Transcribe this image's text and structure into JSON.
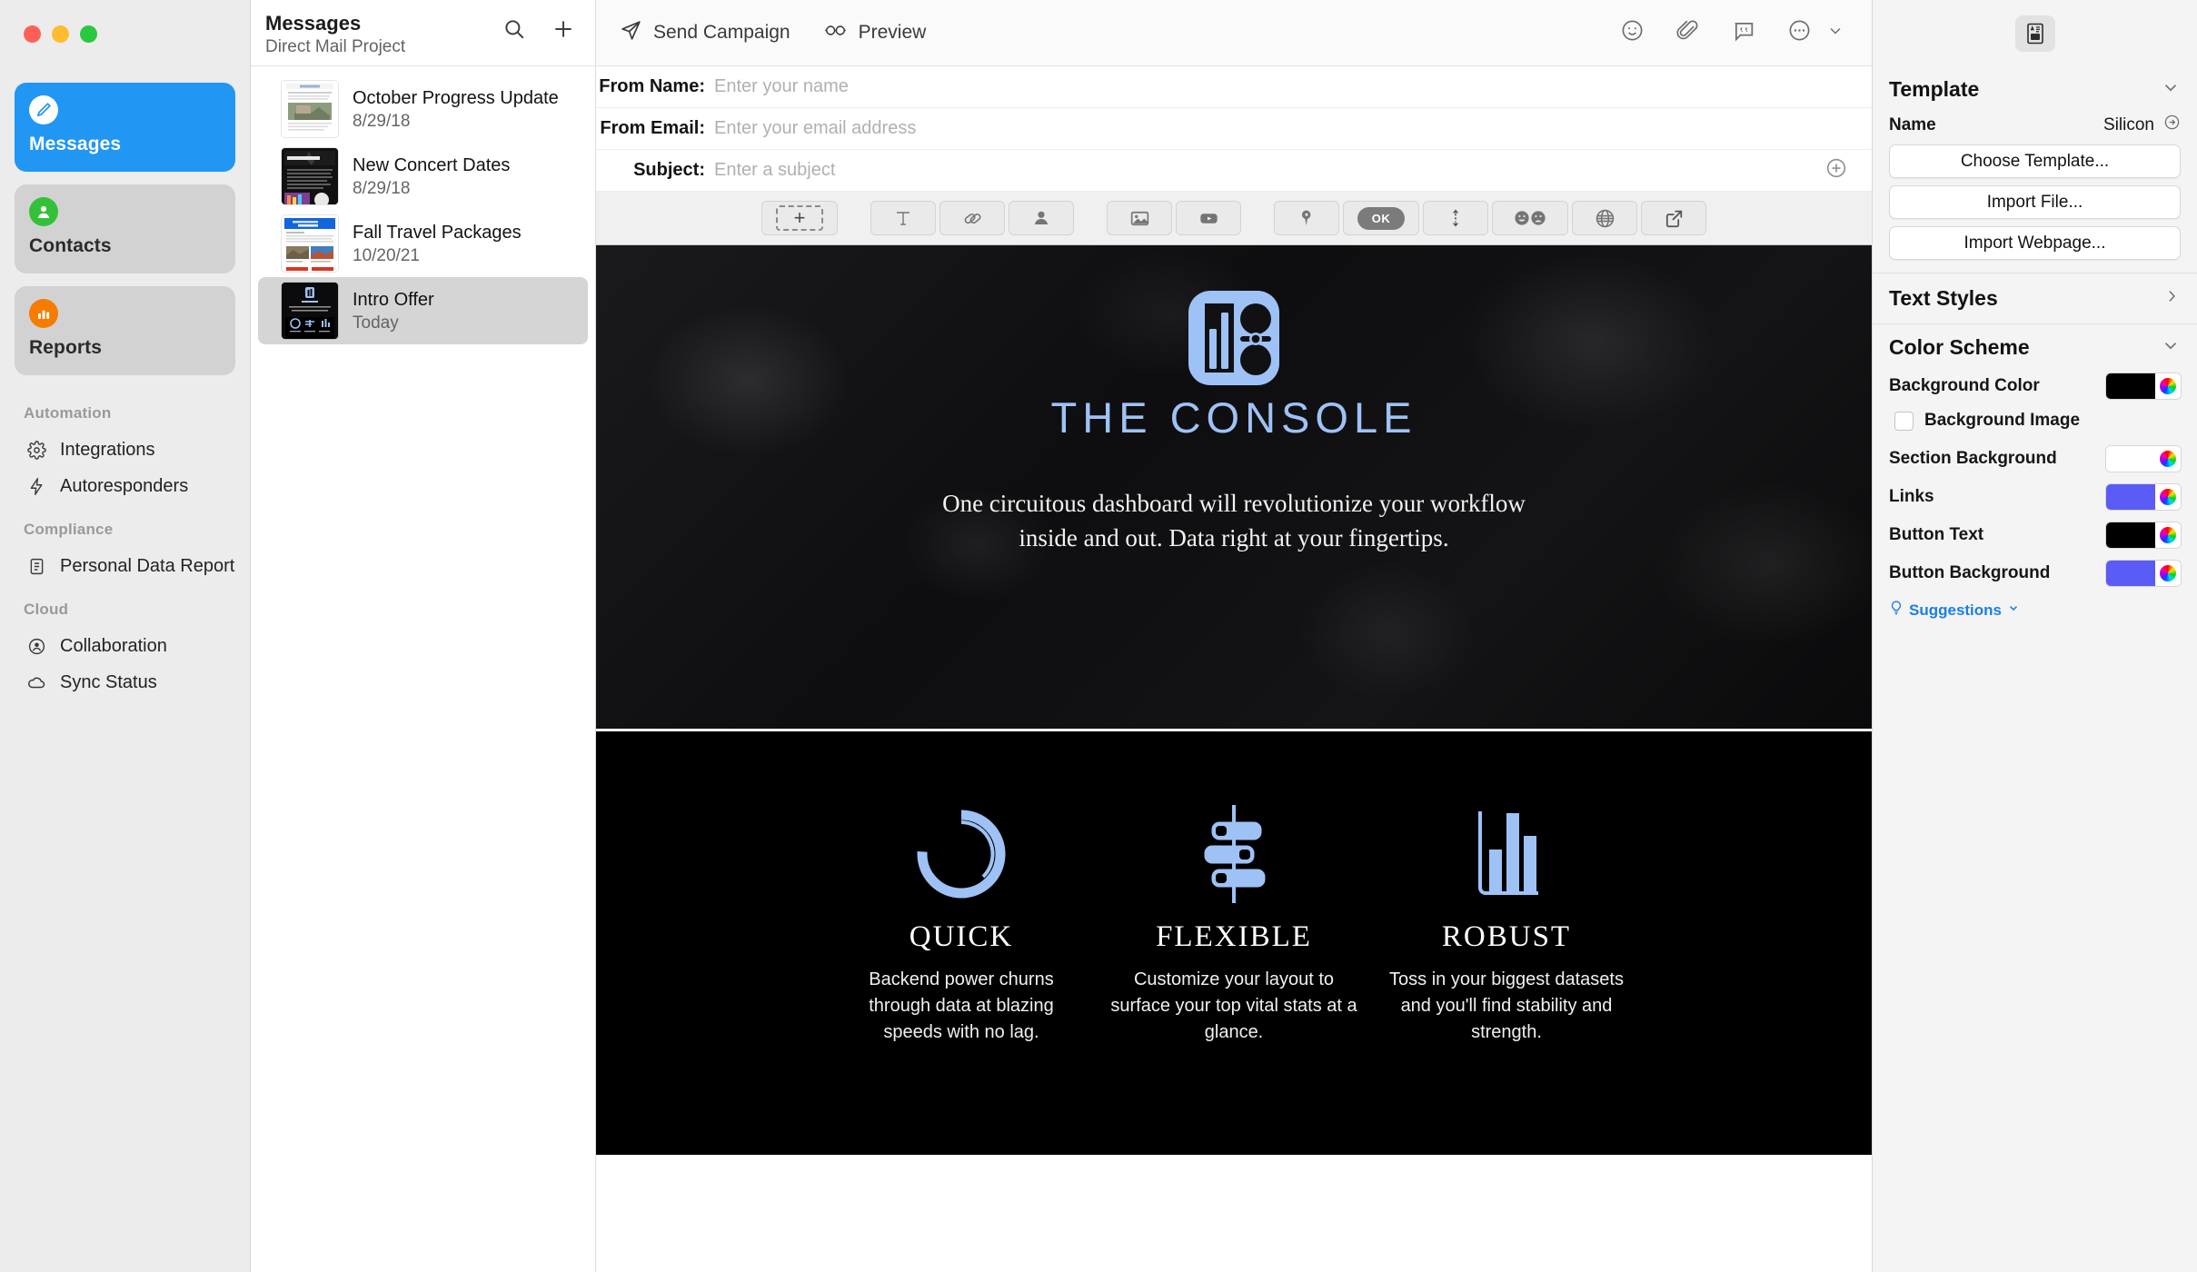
{
  "window": {
    "traffic_lights": [
      "close",
      "minimize",
      "zoom"
    ]
  },
  "sidebar": {
    "primary": [
      {
        "label": "Messages",
        "icon": "compose-icon",
        "active": true
      },
      {
        "label": "Contacts",
        "icon": "person-icon",
        "active": false
      },
      {
        "label": "Reports",
        "icon": "bar-chart-icon",
        "active": false
      }
    ],
    "groups": [
      {
        "title": "Automation",
        "items": [
          {
            "label": "Integrations",
            "icon": "gear-icon"
          },
          {
            "label": "Autoresponders",
            "icon": "bolt-icon"
          }
        ]
      },
      {
        "title": "Compliance",
        "items": [
          {
            "label": "Personal Data Report",
            "icon": "document-icon"
          }
        ]
      },
      {
        "title": "Cloud",
        "items": [
          {
            "label": "Collaboration",
            "icon": "person-circle-icon"
          },
          {
            "label": "Sync Status",
            "icon": "cloud-icon"
          }
        ]
      }
    ]
  },
  "message_list": {
    "title": "Messages",
    "subtitle": "Direct Mail Project",
    "search_icon": "search-icon",
    "add_icon": "plus-icon",
    "items": [
      {
        "name": "October Progress Update",
        "date": "8/29/18",
        "selected": false
      },
      {
        "name": "New Concert Dates",
        "date": "8/29/18",
        "selected": false
      },
      {
        "name": "Fall Travel Packages",
        "date": "10/20/21",
        "selected": false
      },
      {
        "name": "Intro Offer",
        "date": "Today",
        "selected": true
      }
    ]
  },
  "toolbar": {
    "send_label": "Send Campaign",
    "send_icon": "paper-plane-icon",
    "preview_label": "Preview",
    "preview_icon": "glasses-icon",
    "right_icons": [
      "smiley-icon",
      "paperclip-icon",
      "comment-quote-icon",
      "more-circle-icon",
      "chevron-down-icon"
    ]
  },
  "fields": [
    {
      "label": "From Name:",
      "value": "",
      "placeholder": "Enter your name",
      "name": "from-name"
    },
    {
      "label": "From Email:",
      "value": "",
      "placeholder": "Enter your email address",
      "name": "from-email"
    },
    {
      "label": "Subject:",
      "value": "",
      "placeholder": "Enter a subject",
      "name": "subject"
    }
  ],
  "subject_add_icon": "plus-circle-icon",
  "editor_toolbar": {
    "groups": [
      {
        "buttons": [
          {
            "icon": "add-block-icon",
            "label": "+"
          }
        ]
      },
      {
        "buttons": [
          {
            "icon": "text-icon",
            "label": "T"
          },
          {
            "icon": "link-icon",
            "label": ""
          },
          {
            "icon": "person-icon",
            "label": ""
          }
        ]
      },
      {
        "buttons": [
          {
            "icon": "image-icon",
            "label": ""
          },
          {
            "icon": "video-icon",
            "label": ""
          }
        ]
      },
      {
        "buttons": [
          {
            "icon": "map-pin-icon",
            "label": ""
          },
          {
            "icon": "ok-button-icon",
            "label": "OK"
          },
          {
            "icon": "spacer-icon",
            "label": ""
          },
          {
            "icon": "happy-sad-icon",
            "label": ""
          },
          {
            "icon": "globe-icon",
            "label": ""
          },
          {
            "icon": "share-icon",
            "label": ""
          }
        ]
      }
    ]
  },
  "email": {
    "brand_name": "THE CONSOLE",
    "logo_icon": "console-dashboard-logo",
    "tagline_line1": "One circuitous dashboard will revolutionize your workflow",
    "tagline_line2": "inside and out. Data right at your fingertips.",
    "accent_color": "#9ec2f5",
    "background_color": "#000000",
    "features": [
      {
        "icon": "donut-chart-icon",
        "title": "QUICK",
        "body": "Backend power churns through data at blazing speeds with no lag."
      },
      {
        "icon": "sliders-icon",
        "title": "FLEXIBLE",
        "body": "Customize your layout to surface your top vital stats at a glance."
      },
      {
        "icon": "bar-graph-icon",
        "title": "ROBUST",
        "body": "Toss in your biggest datasets and you'll find stability and strength."
      }
    ]
  },
  "inspector": {
    "tool_icon": "template-layout-icon",
    "template": {
      "heading": "Template",
      "collapse_icon": "chevron-down-icon",
      "name_label": "Name",
      "name_value": "Silicon",
      "reveal_icon": "arrow-right-circle-icon",
      "buttons": [
        "Choose Template...",
        "Import File...",
        "Import Webpage..."
      ]
    },
    "text_styles": {
      "heading": "Text Styles",
      "disclosure_icon": "chevron-right-icon"
    },
    "color_scheme": {
      "heading": "Color Scheme",
      "collapse_icon": "chevron-down-icon",
      "rows": [
        {
          "label": "Background Color",
          "color": "#000000"
        },
        {
          "label": "Section Background",
          "color": "#ffffff"
        },
        {
          "label": "Links",
          "color": "#5b5bf5"
        },
        {
          "label": "Button Text",
          "color": "#000000"
        },
        {
          "label": "Button Background",
          "color": "#5b5bf5"
        }
      ],
      "background_image_label": "Background Image",
      "background_image_checked": false,
      "suggestions_label": "Suggestions",
      "suggestions_icon": "lightbulb-icon",
      "suggestions_chevron": "chevron-down-icon"
    }
  }
}
